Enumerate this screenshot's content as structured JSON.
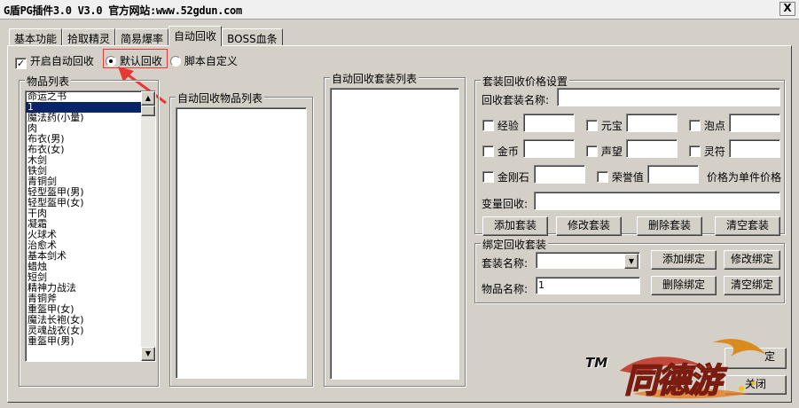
{
  "window": {
    "title": "G盾PG插件3.0 V3.0  官方网站:www.52gdun.com",
    "close_glyph": "X"
  },
  "tabs": [
    {
      "label": "基本功能"
    },
    {
      "label": "拾取精灵"
    },
    {
      "label": "简易爆率"
    },
    {
      "label": "自动回收",
      "active": true
    },
    {
      "label": "BOSS血条"
    }
  ],
  "auto_recycle": {
    "enable_label": "开启自动回收",
    "enable_checked": true,
    "mode_default_label": "默认回收",
    "mode_script_label": "脚本自定义",
    "selected_mode": "默认回收"
  },
  "item_list": {
    "title": "物品列表",
    "items": [
      "命运之书",
      "1",
      "魔法药(小量)",
      "肉",
      "布衣(男)",
      "布衣(女)",
      "木剑",
      "铁剑",
      "青铜剑",
      "轻型盔甲(男)",
      "轻型盔甲(女)",
      "干肉",
      "凝霜",
      "火球术",
      "治愈术",
      "基本剑术",
      "蜡烛",
      "短剑",
      "精神力战法",
      "青铜斧",
      "重盔甲(女)",
      "魔法长袍(女)",
      "灵魂战衣(女)",
      "重盔甲(男)"
    ],
    "selected_index": 1
  },
  "recycle_items_list": {
    "title": "自动回收物品列表"
  },
  "recycle_sets_list": {
    "title": "自动回收套装列表"
  },
  "price_settings": {
    "title": "套装回收价格设置",
    "set_name_label": "回收套装名称:",
    "fields": [
      {
        "label": "经验"
      },
      {
        "label": "元宝"
      },
      {
        "label": "泡点"
      },
      {
        "label": "金币"
      },
      {
        "label": "声望"
      },
      {
        "label": "灵符"
      },
      {
        "label": "金刚石"
      },
      {
        "label": "荣誉值"
      }
    ],
    "unit_price_note": "价格为单件价格",
    "var_recycle_label": "变量回收:",
    "buttons": {
      "add": "添加套装",
      "modify": "修改套装",
      "delete": "删除套装",
      "clear": "清空套装"
    }
  },
  "bind_sets": {
    "title": "绑定回收套装",
    "set_name_label": "套装名称:",
    "item_name_label": "物品名称:",
    "item_name_value": "1",
    "buttons": {
      "add": "添加绑定",
      "modify": "修改绑定",
      "delete": "删除绑定",
      "clear": "清空绑定"
    }
  },
  "footer": {
    "close_label": "关闭",
    "partial_button_label": "定"
  },
  "logo": {
    "tm": "TM",
    "text": "同德游"
  },
  "colors": {
    "selection": "#0a246a",
    "annotation": "#e53935",
    "face": "#d4d0c8"
  }
}
